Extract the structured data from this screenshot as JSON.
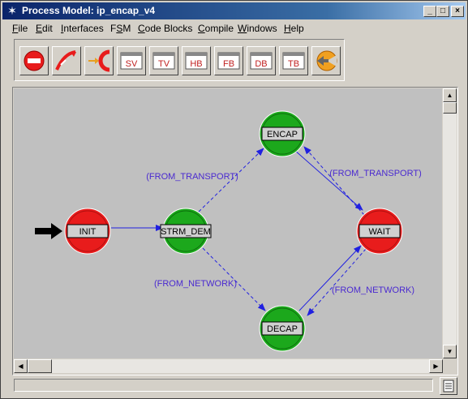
{
  "window": {
    "title": "Process Model: ip_encap_v4",
    "controls": {
      "minimize": "_",
      "maximize": "□",
      "close": "×"
    }
  },
  "menu": [
    {
      "label": "File",
      "accel": "F"
    },
    {
      "label": "Edit",
      "accel": "E"
    },
    {
      "label": "Interfaces",
      "accel": "I"
    },
    {
      "label": "FSM",
      "accel": "S"
    },
    {
      "label": "Code Blocks",
      "accel": "C"
    },
    {
      "label": "Compile",
      "accel": "C"
    },
    {
      "label": "Windows",
      "accel": "W"
    },
    {
      "label": "Help",
      "accel": "H"
    }
  ],
  "toolbar": [
    {
      "icon": "create-state-icon"
    },
    {
      "icon": "create-transition-icon"
    },
    {
      "icon": "set-initial-state-icon"
    },
    {
      "icon": "state-variables-icon",
      "label": "SV"
    },
    {
      "icon": "temporary-variables-icon",
      "label": "TV"
    },
    {
      "icon": "header-block-icon",
      "label": "HB"
    },
    {
      "icon": "function-block-icon",
      "label": "FB"
    },
    {
      "icon": "diagnostic-block-icon",
      "label": "DB"
    },
    {
      "icon": "termination-block-icon",
      "label": "TB"
    },
    {
      "icon": "compile-icon"
    }
  ],
  "fsm": {
    "colors": {
      "forced": "#1ca81c",
      "unforced": "#e81c1c",
      "transition": "#2020e0",
      "condition": "#4a2ad0"
    },
    "states": [
      {
        "id": "INIT",
        "label": "INIT",
        "type": "unforced",
        "initial": true
      },
      {
        "id": "STRM_DEM",
        "label": "STRM_DEM",
        "type": "forced"
      },
      {
        "id": "ENCAP",
        "label": "ENCAP",
        "type": "forced"
      },
      {
        "id": "DECAP",
        "label": "DECAP",
        "type": "forced"
      },
      {
        "id": "WAIT",
        "label": "WAIT",
        "type": "unforced"
      }
    ],
    "conditions": {
      "strm_to_encap": "(FROM_TRANSPORT)",
      "strm_to_decap": "(FROM_NETWORK)",
      "wait_to_encap": "(FROM_TRANSPORT)",
      "wait_to_decap": "(FROM_NETWORK)"
    }
  }
}
